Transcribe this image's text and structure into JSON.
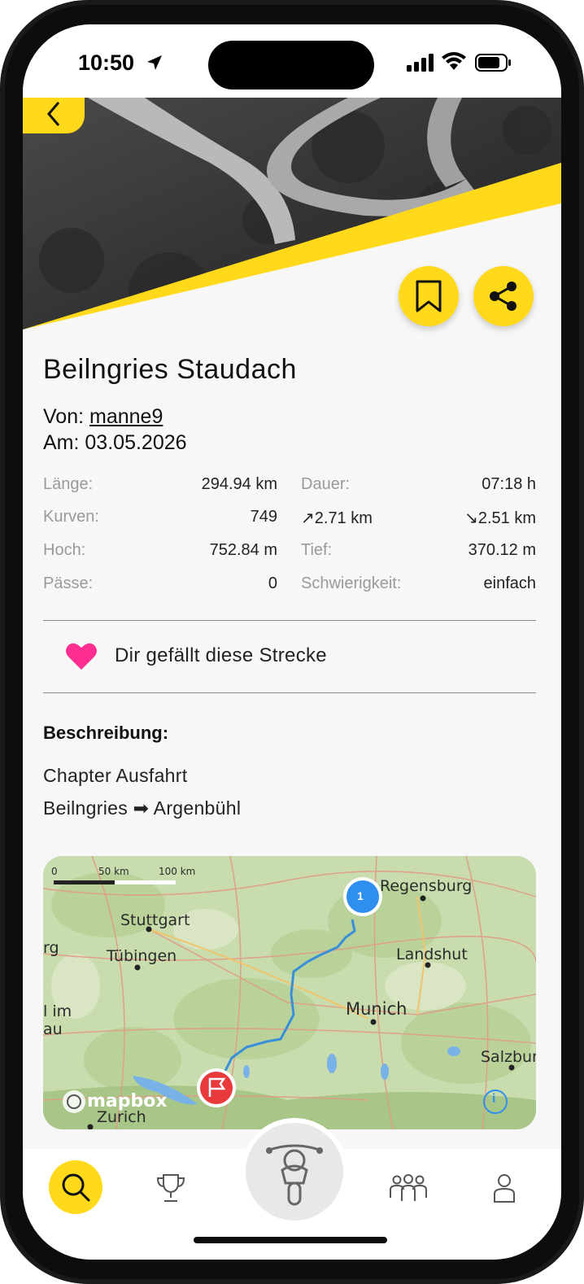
{
  "status_bar": {
    "time": "10:50"
  },
  "route": {
    "title": "Beilngries Staudach",
    "author_label": "Von:",
    "author": "manne9",
    "date_label": "Am:",
    "date": "03.05.2026"
  },
  "stats": {
    "laenge_label": "Länge:",
    "laenge_value": "294.94 km",
    "dauer_label": "Dauer:",
    "dauer_value": "07:18 h",
    "kurven_label": "Kurven:",
    "kurven_value": "749",
    "ascent_value": "↗2.71 km",
    "descent_value": "↘2.51 km",
    "hoch_label": "Hoch:",
    "hoch_value": "752.84 m",
    "tief_label": "Tief:",
    "tief_value": "370.12 m",
    "paesse_label": "Pässe:",
    "paesse_value": "0",
    "schwierigkeit_label": "Schwierigkeit:",
    "schwierigkeit_value": "einfach"
  },
  "like": {
    "text": "Dir gefällt diese Strecke",
    "color": "#ff2f92"
  },
  "description": {
    "heading": "Beschreibung:",
    "line1": "Chapter Ausfahrt",
    "line2": "Beilngries ➡ Argenbühl"
  },
  "map": {
    "scale_0": "0",
    "scale_50": "50 km",
    "scale_100": "100 km",
    "cities": {
      "regensburg": "Regensburg",
      "stuttgart": "Stuttgart",
      "tuebingen": "Tübingen",
      "landshut": "Landshut",
      "munich": "Munich",
      "salzburg": "Salzbur",
      "zurich": "Zurich",
      "rg": "rg",
      "im": "l im",
      "au": "au"
    },
    "start_marker": "1",
    "attribution": "mapbox",
    "info": "i"
  },
  "colors": {
    "accent": "#ffd91a",
    "route": "#3a8fd9",
    "marker_start": "#2f8ff0",
    "marker_end": "#e8393b"
  },
  "nav": {
    "items": [
      {
        "icon": "search-icon",
        "active": true
      },
      {
        "icon": "trophy-icon",
        "active": false
      },
      {
        "icon": "motorcycle-icon",
        "active": false
      },
      {
        "icon": "group-icon",
        "active": false
      },
      {
        "icon": "profile-icon",
        "active": false
      }
    ]
  }
}
